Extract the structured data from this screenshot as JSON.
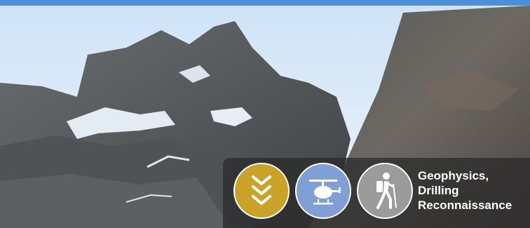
{
  "banner": {
    "accent_color": "#4a90d9",
    "icons": [
      {
        "name": "chevrons-down-icon",
        "color": "#c9a227"
      },
      {
        "name": "helicopter-icon",
        "color": "#7f9fd6"
      },
      {
        "name": "hiker-icon",
        "color": "#9b9b9b"
      }
    ],
    "caption_lines": [
      "Geophysics,",
      "Drilling",
      "Reconnaissance"
    ]
  }
}
